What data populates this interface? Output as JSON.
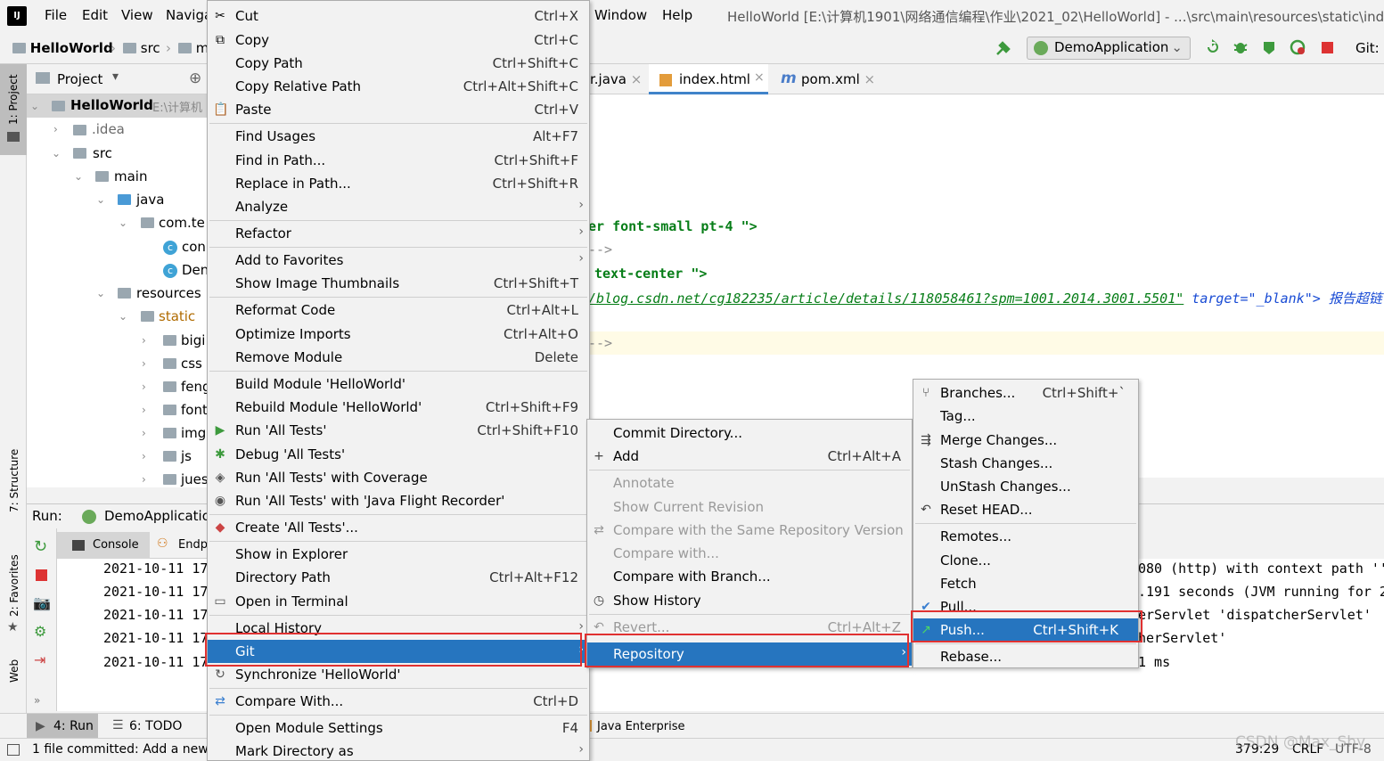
{
  "menubar": {
    "logo": "IJ",
    "items": [
      "File",
      "Edit",
      "View",
      "Naviga",
      "Window",
      "Help"
    ],
    "title": "HelloWorld [E:\\计算机1901\\网络通信编程\\作业\\2021_02\\HelloWorld] - ...\\src\\main\\resources\\static\\inde"
  },
  "breadcrumb": [
    "HelloWorld",
    "src",
    "m"
  ],
  "toolbar": {
    "run_config": "DemoApplication",
    "git_label": "Git:"
  },
  "project": {
    "header": "Project",
    "root": "HelloWorld",
    "root_path": "E:\\计算机",
    "nodes": [
      ".idea",
      "src",
      "main",
      "java",
      "com.te",
      "con",
      "Den",
      "resources",
      "static",
      "bigi",
      "css",
      "feng",
      "font",
      "img",
      "js",
      "jues"
    ]
  },
  "left_stripe": {
    "project_tab": "1: Project",
    "structure_tab": "7: Structure",
    "favorites_tab": "2: Favorites",
    "web_tab": "Web"
  },
  "editor": {
    "tabs": [
      "r.java",
      "index.html",
      "pom.xml"
    ],
    "lines": [
      {
        "text": "er font-small pt-4 \">",
        "type": "str"
      },
      {
        "text": "-->",
        "type": "cmt"
      },
      {
        "text": "text-center \">",
        "type": "str"
      },
      {
        "text": "/blog.csdn.net/cg182235/article/details/118058461?spm=1001.2014.3001.5501\"",
        "type": "link"
      },
      {
        "text": " target=\"_blank\"> 报告超链",
        "type": "attr"
      },
      {
        "text": "-->",
        "type": "cmt"
      }
    ]
  },
  "run": {
    "label": "Run:",
    "config": "DemoApplicatio",
    "console_tab": "Console",
    "endpoints_tab": "Endp",
    "log_prefix": "2021-10-11 17",
    "log_right": [
      "080 (http) with context path ''",
      ".191 seconds (JVM running for 2",
      "erServlet 'dispatcherServlet'",
      "herServlet'",
      "1 ms"
    ]
  },
  "bottom_tabs": [
    "4: Run",
    "6: TODO",
    "Java Enterprise"
  ],
  "status": {
    "message": "1 file committed: Add a new",
    "position": "379:29",
    "line_sep": "CRLF",
    "encoding": "UTF-8",
    "watermark": "CSDN @Max_Shy"
  },
  "context_menu": [
    {
      "label": "Cut",
      "shortcut": "Ctrl+X",
      "icon": "scissors-icon"
    },
    {
      "label": "Copy",
      "shortcut": "Ctrl+C",
      "icon": "copy-icon"
    },
    {
      "label": "Copy Path",
      "shortcut": "Ctrl+Shift+C"
    },
    {
      "label": "Copy Relative Path",
      "shortcut": "Ctrl+Alt+Shift+C"
    },
    {
      "label": "Paste",
      "shortcut": "Ctrl+V",
      "icon": "paste-icon"
    },
    {
      "label": "Find Usages",
      "shortcut": "Alt+F7"
    },
    {
      "label": "Find in Path...",
      "shortcut": "Ctrl+Shift+F"
    },
    {
      "label": "Replace in Path...",
      "shortcut": "Ctrl+Shift+R"
    },
    {
      "label": "Analyze",
      "submenu": true
    },
    {
      "label": "Refactor",
      "submenu": true
    },
    {
      "label": "Add to Favorites",
      "submenu": true
    },
    {
      "label": "Show Image Thumbnails",
      "shortcut": "Ctrl+Shift+T"
    },
    {
      "label": "Reformat Code",
      "shortcut": "Ctrl+Alt+L"
    },
    {
      "label": "Optimize Imports",
      "shortcut": "Ctrl+Alt+O"
    },
    {
      "label": "Remove Module",
      "shortcut": "Delete"
    },
    {
      "label": "Build Module 'HelloWorld'"
    },
    {
      "label": "Rebuild Module 'HelloWorld'",
      "shortcut": "Ctrl+Shift+F9"
    },
    {
      "label": "Run 'All Tests'",
      "shortcut": "Ctrl+Shift+F10",
      "icon": "run-icon"
    },
    {
      "label": "Debug 'All Tests'",
      "icon": "debug-icon"
    },
    {
      "label": "Run 'All Tests' with Coverage",
      "icon": "coverage-icon"
    },
    {
      "label": "Run 'All Tests' with 'Java Flight Recorder'",
      "icon": "profiler-icon"
    },
    {
      "label": "Create 'All Tests'...",
      "icon": "create-test-icon"
    },
    {
      "label": "Show in Explorer"
    },
    {
      "label": "Directory Path",
      "shortcut": "Ctrl+Alt+F12"
    },
    {
      "label": "Open in Terminal",
      "icon": "terminal-icon"
    },
    {
      "label": "Local History",
      "submenu": true
    },
    {
      "label": "Git",
      "submenu": true
    },
    {
      "label": "Synchronize 'HelloWorld'",
      "icon": "sync-icon"
    },
    {
      "label": "Compare With...",
      "shortcut": "Ctrl+D",
      "icon": "compare-icon"
    },
    {
      "label": "Open Module Settings",
      "shortcut": "F4"
    },
    {
      "label": "Mark Directory as",
      "submenu": true
    }
  ],
  "git_menu": [
    {
      "label": "Commit Directory..."
    },
    {
      "label": "Add",
      "shortcut": "Ctrl+Alt+A",
      "icon": "plus-icon"
    },
    {
      "label": "Annotate"
    },
    {
      "label": "Show Current Revision"
    },
    {
      "label": "Compare with the Same Repository Version"
    },
    {
      "label": "Compare with..."
    },
    {
      "label": "Compare with Branch..."
    },
    {
      "label": "Show History",
      "icon": "history-icon"
    },
    {
      "label": "Revert...",
      "shortcut": "Ctrl+Alt+Z",
      "icon": "revert-icon"
    },
    {
      "label": "Repository",
      "submenu": true
    }
  ],
  "repo_menu": [
    {
      "label": "Branches...",
      "shortcut": "Ctrl+Shift+`",
      "icon": "branch-icon"
    },
    {
      "label": "Tag..."
    },
    {
      "label": "Merge Changes...",
      "icon": "merge-icon"
    },
    {
      "label": "Stash Changes..."
    },
    {
      "label": "UnStash Changes..."
    },
    {
      "label": "Reset HEAD...",
      "icon": "reset-icon"
    },
    {
      "label": "Remotes..."
    },
    {
      "label": "Clone..."
    },
    {
      "label": "Fetch"
    },
    {
      "label": "Pull...",
      "icon": "pull-icon"
    },
    {
      "label": "Push...",
      "shortcut": "Ctrl+Shift+K",
      "icon": "push-icon"
    },
    {
      "label": "Rebase..."
    }
  ],
  "colors": {
    "selection": "#2675bf",
    "highlight_box": "#e03131"
  }
}
